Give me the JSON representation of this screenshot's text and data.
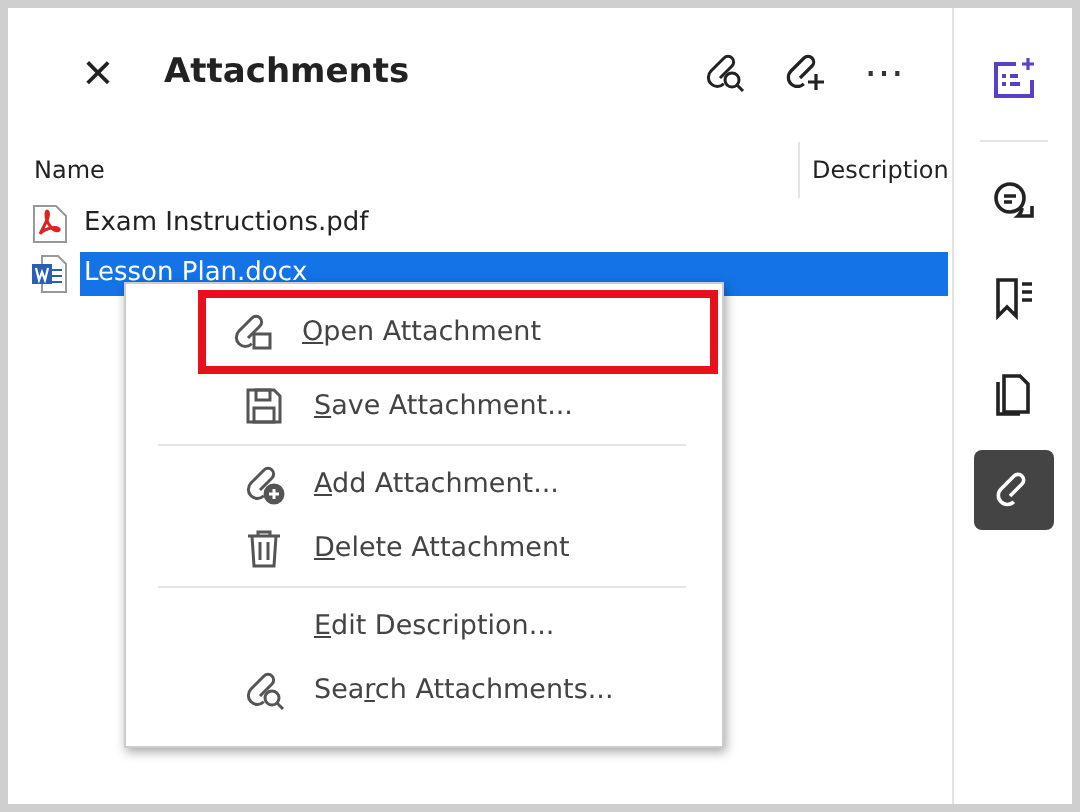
{
  "header": {
    "close": "×",
    "title": "Attachments",
    "more": "⋯"
  },
  "columns": [
    {
      "label": "Name"
    },
    {
      "label": "Description"
    }
  ],
  "files": [
    {
      "name": "Exam Instructions.pdf",
      "kind": "pdf",
      "selected": false
    },
    {
      "name": "Lesson Plan.docx",
      "kind": "word",
      "selected": true
    }
  ],
  "context_menu": [
    {
      "kind": "item",
      "key": "O",
      "after": "pen Attachment",
      "highlighted": true
    },
    {
      "kind": "item",
      "key": "S",
      "after": "ave Attachment...",
      "highlighted": false
    },
    {
      "kind": "separator"
    },
    {
      "kind": "item",
      "key": "A",
      "after": "dd Attachment...",
      "highlighted": false
    },
    {
      "kind": "item",
      "key": "D",
      "after": "elete Attachment",
      "highlighted": false
    },
    {
      "kind": "separator"
    },
    {
      "kind": "item",
      "key": "E",
      "after": "dit Description...",
      "highlighted": false
    },
    {
      "kind": "item",
      "before": "Sea",
      "key": "r",
      "after": "ch Attachments...",
      "highlighted": false
    }
  ],
  "sidebar": [
    {
      "selected": false
    },
    {
      "selected": false
    },
    {
      "selected": false
    },
    {
      "selected": false
    },
    {
      "selected": true
    }
  ]
}
